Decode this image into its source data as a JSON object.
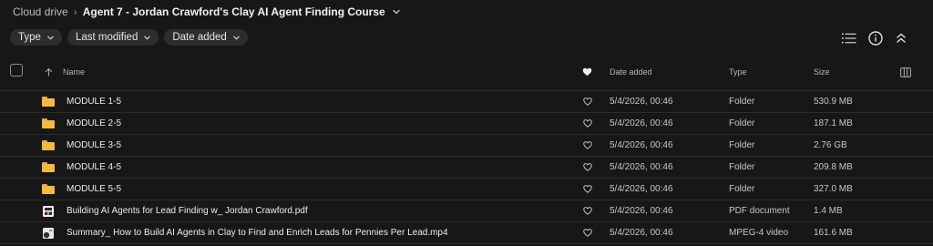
{
  "breadcrumb": {
    "root": "Cloud drive",
    "separator": "›",
    "current": "Agent 7 - Jordan Crawford's Clay AI Agent Finding Course"
  },
  "filters": [
    {
      "label": "Type"
    },
    {
      "label": "Last modified"
    },
    {
      "label": "Date added"
    }
  ],
  "toolbar": {
    "list_view_icon": "list-view-icon",
    "info_icon": "info-icon",
    "collapse_icon": "collapse-icon"
  },
  "table": {
    "headers": {
      "name": "Name",
      "date_added": "Date added",
      "type": "Type",
      "size": "Size"
    },
    "rows": [
      {
        "icon": "folder-icon",
        "name": "MODULE 1-5",
        "date": "5/4/2026, 00:46",
        "type": "Folder",
        "size": "530.9 MB"
      },
      {
        "icon": "folder-icon",
        "name": "MODULE 2-5",
        "date": "5/4/2026, 00:46",
        "type": "Folder",
        "size": "187.1 MB"
      },
      {
        "icon": "folder-icon",
        "name": "MODULE 3-5",
        "date": "5/4/2026, 00:46",
        "type": "Folder",
        "size": "2.76 GB"
      },
      {
        "icon": "folder-icon",
        "name": "MODULE 4-5",
        "date": "5/4/2026, 00:46",
        "type": "Folder",
        "size": "209.8 MB"
      },
      {
        "icon": "folder-icon",
        "name": "MODULE 5-5",
        "date": "5/4/2026, 00:46",
        "type": "Folder",
        "size": "327.0 MB"
      },
      {
        "icon": "pdf-thumbnail-icon",
        "name": "Building AI Agents for Lead Finding w_ Jordan Crawford.pdf",
        "date": "5/4/2026, 00:46",
        "type": "PDF document",
        "size": "1.4 MB"
      },
      {
        "icon": "video-thumbnail-icon",
        "name": "Summary_ How to Build AI Agents in Clay to Find and Enrich Leads for Pennies Per Lead.mp4",
        "date": "5/4/2026, 00:46",
        "type": "MPEG-4 video",
        "size": "161.6 MB"
      }
    ]
  },
  "colors": {
    "background": "#171717",
    "chip": "#2d2d2d",
    "folder": "#f5b942",
    "row_divider": "#2c2c2c"
  }
}
